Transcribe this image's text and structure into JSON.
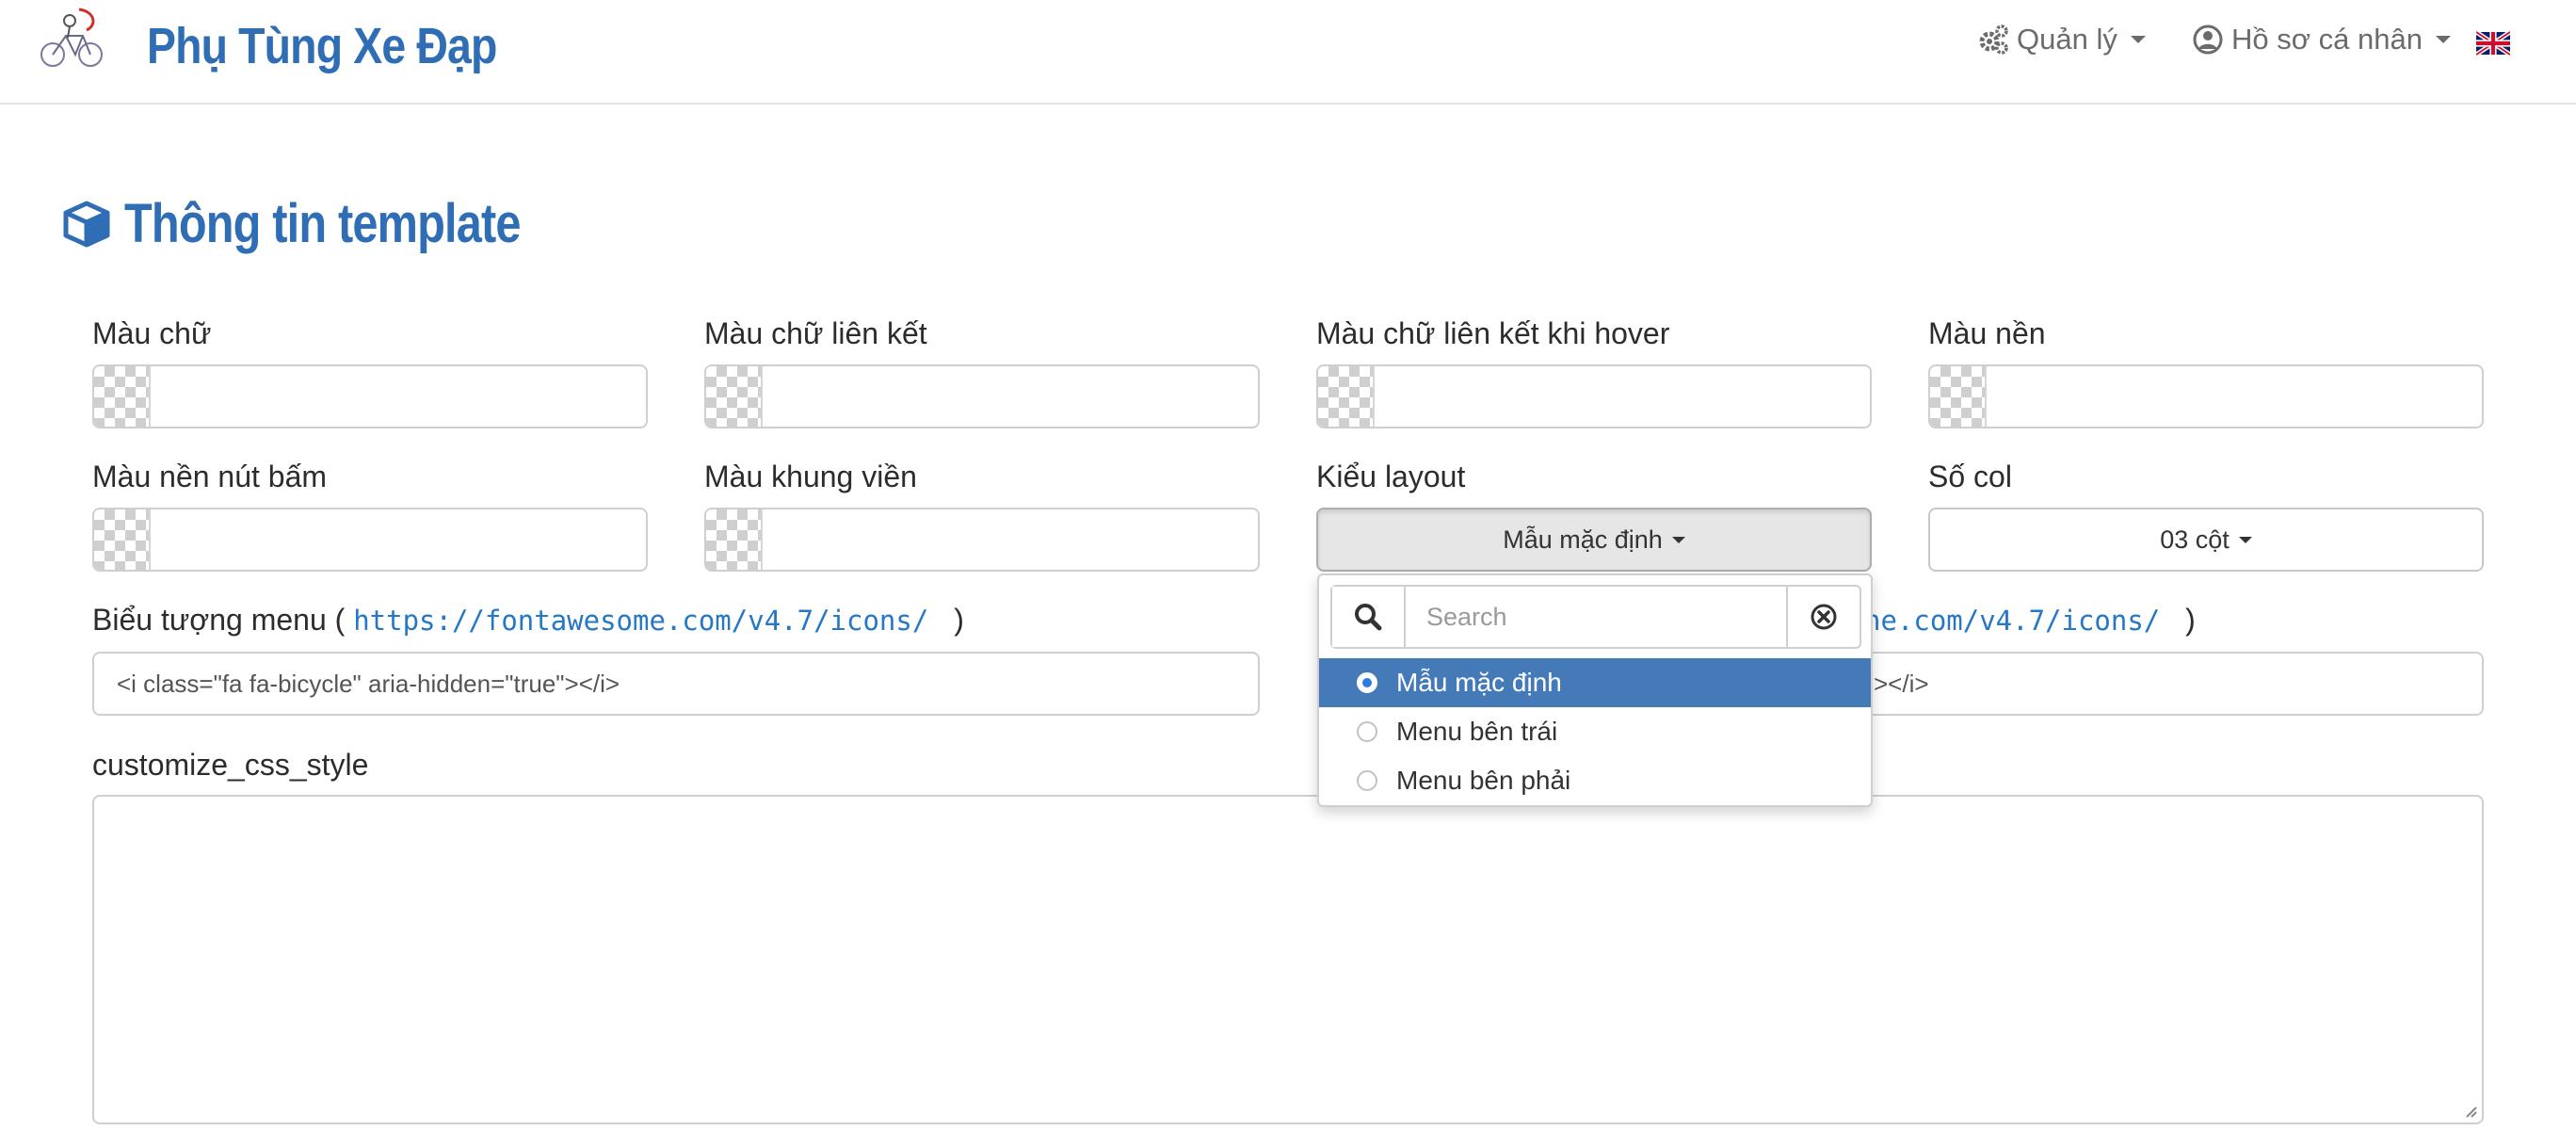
{
  "header": {
    "brand": "Phụ Tùng Xe Đạp",
    "nav": {
      "manage_label": "Quản lý",
      "profile_label": "Hồ sơ cá nhân"
    }
  },
  "page": {
    "title": "Thông tin template"
  },
  "form": {
    "text_color_label": "Màu chữ",
    "link_color_label": "Màu chữ liên kết",
    "link_hover_color_label": "Màu chữ liên kết khi hover",
    "background_color_label": "Màu nền",
    "button_background_label": "Màu nền nút bấm",
    "border_color_label": "Màu khung viền",
    "layout_label": "Kiểu layout",
    "layout_value": "Mẫu mặc định",
    "columns_label": "Số col",
    "columns_value": "03 cột",
    "menu_icon_label": "Biểu tượng menu",
    "menu_icon_paren_open": "(",
    "menu_icon_link": "https://fontawesome.com/v4.7/icons/",
    "menu_icon_paren_close": ")",
    "menu_icon_value": "<i class=\"fa fa-bicycle\" aria-hidden=\"true\"></i>",
    "second_icon_link_partial": "ne.com/v4.7/icons/",
    "second_icon_paren_close": ")",
    "second_icon_value_partial": "></i>",
    "css_label": "customize_css_style",
    "css_value": ""
  },
  "layout_dropdown": {
    "search_placeholder": "Search",
    "options": [
      {
        "label": "Mẫu mặc định",
        "selected": true
      },
      {
        "label": "Menu bên trái",
        "selected": false
      },
      {
        "label": "Menu bên phải",
        "selected": false
      }
    ]
  },
  "colors": {
    "brand": "#2f6db5",
    "link": "#2577c7",
    "selected_option": "#447ab8"
  }
}
